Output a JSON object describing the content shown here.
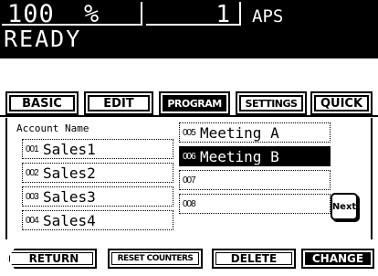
{
  "status": {
    "zoom": "100",
    "zoom_unit": "%",
    "copies": "1",
    "mode": "APS",
    "message": "READY"
  },
  "tabs": [
    {
      "label": "BASIC"
    },
    {
      "label": "EDIT"
    },
    {
      "label": "PROGRAM"
    },
    {
      "label": "SETTINGS"
    },
    {
      "label": "QUICK"
    }
  ],
  "panel": {
    "account_label": "Account Name",
    "accounts": [
      {
        "num": "001",
        "name": "Sales1"
      },
      {
        "num": "002",
        "name": "Sales2"
      },
      {
        "num": "003",
        "name": "Sales3"
      },
      {
        "num": "004",
        "name": "Sales4"
      },
      {
        "num": "005",
        "name": "Meeting A"
      },
      {
        "num": "006",
        "name": "Meeting B"
      },
      {
        "num": "007",
        "name": ""
      },
      {
        "num": "008",
        "name": ""
      }
    ],
    "next_label": "Next"
  },
  "bottom": {
    "return_label": "RETURN",
    "reset_label": "RESET COUNTERS",
    "delete_label": "DELETE",
    "change_label": "CHANGE"
  }
}
